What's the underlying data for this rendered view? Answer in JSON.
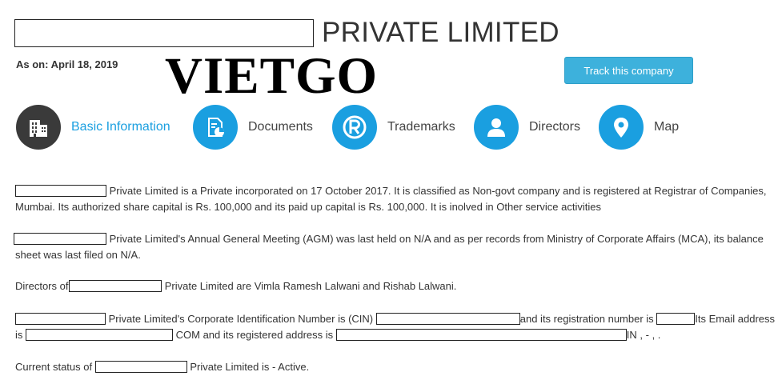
{
  "header": {
    "title_suffix": "PRIVATE LIMITED",
    "as_on": "As on: April 18, 2019",
    "watermark": "VIETGO",
    "track_button": "Track this company"
  },
  "nav": {
    "basic_information": "Basic Information",
    "documents": "Documents",
    "trademarks": "Trademarks",
    "directors": "Directors",
    "map": "Map"
  },
  "body": {
    "p1_text": "Private Limited is a Private incorporated on 17 October 2017. It is classified as Non-govt company and is registered at Registrar of Companies, Mumbai. Its authorized share capital is Rs. 100,000 and its paid up capital is Rs. 100,000. It is inolved in Other service activities",
    "p2_text": "Private Limited's Annual General Meeting (AGM) was last held on N/A and as per records from Ministry of Corporate Affairs (MCA), its balance sheet was last filed on N/A.",
    "p3_prefix": "Directors of",
    "p3_suffix": "Private Limited are Vimla Ramesh Lalwani and Rishab Lalwani.",
    "p4_a": "Private Limited's Corporate Identification Number is (CIN)",
    "p4_b": "and its registration number is",
    "p4_c": "Its Email address is",
    "p4_d": "COM and its registered address is",
    "p4_e": "IN , - , .",
    "p5_prefix": "Current status of",
    "p5_suffix": "Private Limited is - Active."
  },
  "colors": {
    "accent": "#1a9fe0",
    "button": "#3db1dc",
    "active_icon": "#3a3a3a"
  },
  "icons": [
    "building-icon",
    "document-chart-icon",
    "registered-trademark-icon",
    "person-icon",
    "map-pin-icon"
  ]
}
